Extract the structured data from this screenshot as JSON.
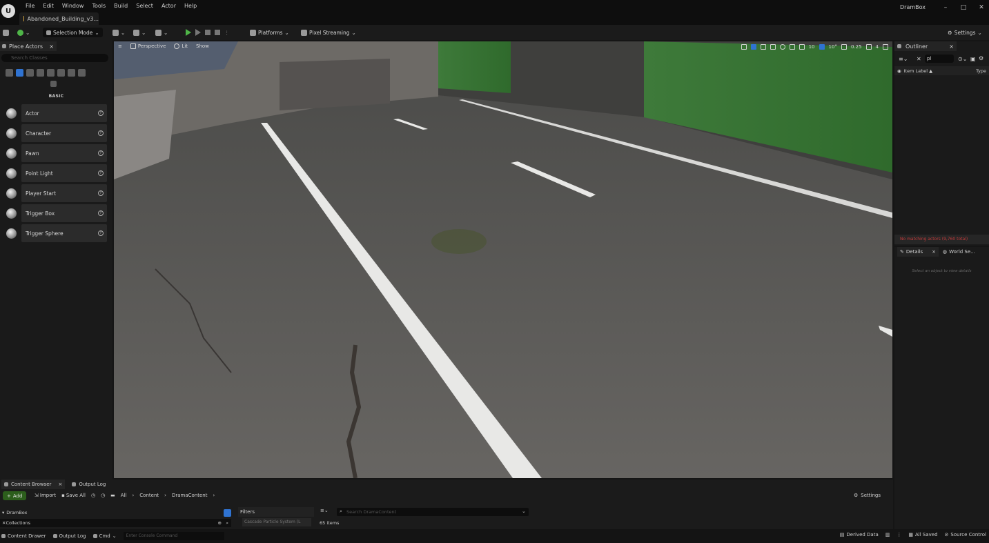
{
  "window": {
    "logo": "U",
    "menu": [
      "File",
      "Edit",
      "Window",
      "Tools",
      "Build",
      "Select",
      "Actor",
      "Help"
    ],
    "doc_tab": "Abandoned_Building_v3...",
    "app_name": "DramBox",
    "controls": [
      "–",
      "□",
      "✕"
    ]
  },
  "toolbar": {
    "mode": "Selection Mode",
    "platforms": "Platforms",
    "pixel_streaming": "Pixel Streaming",
    "settings": "Settings"
  },
  "place_actors": {
    "tab": "Place Actors",
    "close": "×",
    "search_placeholder": "Search Classes",
    "category": "BASIC",
    "items": [
      {
        "label": "Actor"
      },
      {
        "label": "Character"
      },
      {
        "label": "Pawn"
      },
      {
        "label": "Point Light"
      },
      {
        "label": "Player Start"
      },
      {
        "label": "Trigger Box"
      },
      {
        "label": "Trigger Sphere"
      }
    ],
    "help_glyph": "?"
  },
  "viewport": {
    "perspective": "Perspective",
    "lit": "Lit",
    "show": "Show",
    "grid_size": "10",
    "angle": "10°",
    "scale": "0.25",
    "camera_speed": "4"
  },
  "outliner": {
    "tab": "Outliner",
    "close": "×",
    "search_value": "pl",
    "col_label": "Item Label ▲",
    "col_type": "Type",
    "no_match": "No matching actors (9,760 total)"
  },
  "details": {
    "tab_details": "Details",
    "tab_world": "World Se...",
    "close": "×",
    "empty_text": "Select an object to view details"
  },
  "content_browser": {
    "tab": "Content Browser",
    "close": "×",
    "output_log_tab": "Output Log",
    "add": "Add",
    "import": "Import",
    "save_all": "Save All",
    "breadcrumb": [
      "All",
      "Content",
      "DramaContent"
    ],
    "settings": "Settings",
    "source_root": "DramBox",
    "collections": "Collections",
    "filters": "Filters",
    "filter_chip": "Cascade Particle System (L",
    "search_placeholder": "Search DramaContent",
    "items_count": "65 items"
  },
  "statusbar": {
    "content_drawer": "Content Drawer",
    "output_log": "Output Log",
    "cmd": "Cmd",
    "console_placeholder": "Enter Console Command",
    "derived_data": "Derived Data",
    "all_saved": "All Saved",
    "source_control": "Source Control"
  }
}
